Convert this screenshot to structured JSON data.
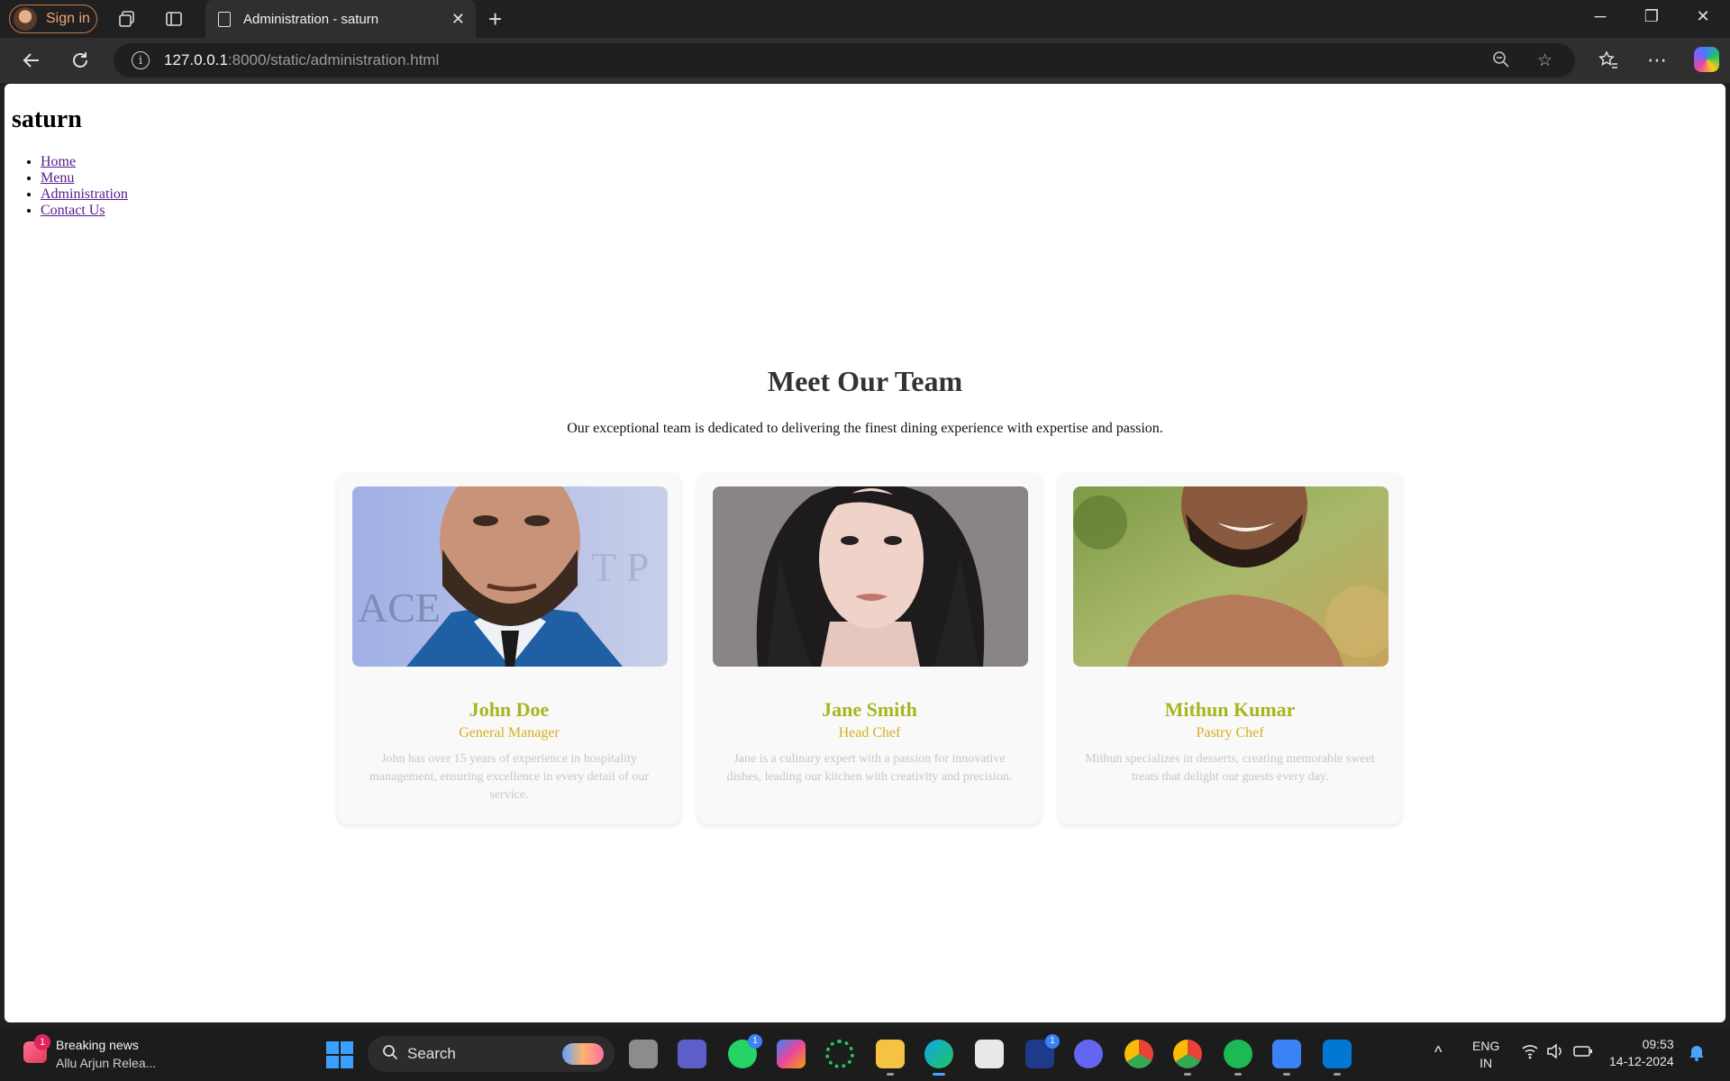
{
  "browser": {
    "sign_in_label": "Sign in",
    "tab_title": "Administration - saturn",
    "url_host": "127.0.0.1",
    "url_rest": ":8000/static/administration.html"
  },
  "site": {
    "title": "saturn",
    "nav": [
      "Home",
      "Menu",
      "Administration",
      "Contact Us"
    ]
  },
  "team": {
    "heading": "Meet Our Team",
    "intro": "Our exceptional team is dedicated to delivering the finest dining experience with expertise and passion.",
    "members": [
      {
        "name": "John Doe",
        "role": "General Manager",
        "description": "John has over 15 years of experience in hospitality management, ensuring excellence in every detail of our service."
      },
      {
        "name": "Jane Smith",
        "role": "Head Chef",
        "description": "Jane is a culinary expert with a passion for innovative dishes, leading our kitchen with creativity and precision."
      },
      {
        "name": "Mithun Kumar",
        "role": "Pastry Chef",
        "description": "Mithun specializes in desserts, creating memorable sweet treats that delight our guests every day."
      }
    ]
  },
  "taskbar": {
    "news_badge": "1",
    "news_title": "Breaking news",
    "news_subtitle": "Allu Arjun Relea...",
    "search_label": "Search",
    "whatsapp_badge": "1",
    "l_app_badge": "1",
    "lang_top": "ENG",
    "lang_bottom": "IN",
    "time": "09:53",
    "date": "14-12-2024"
  },
  "colors": {
    "member_name": "#a6b61e",
    "member_role": "#d4b01c",
    "member_description": "#c7c7c7",
    "link": "#551a8b"
  }
}
